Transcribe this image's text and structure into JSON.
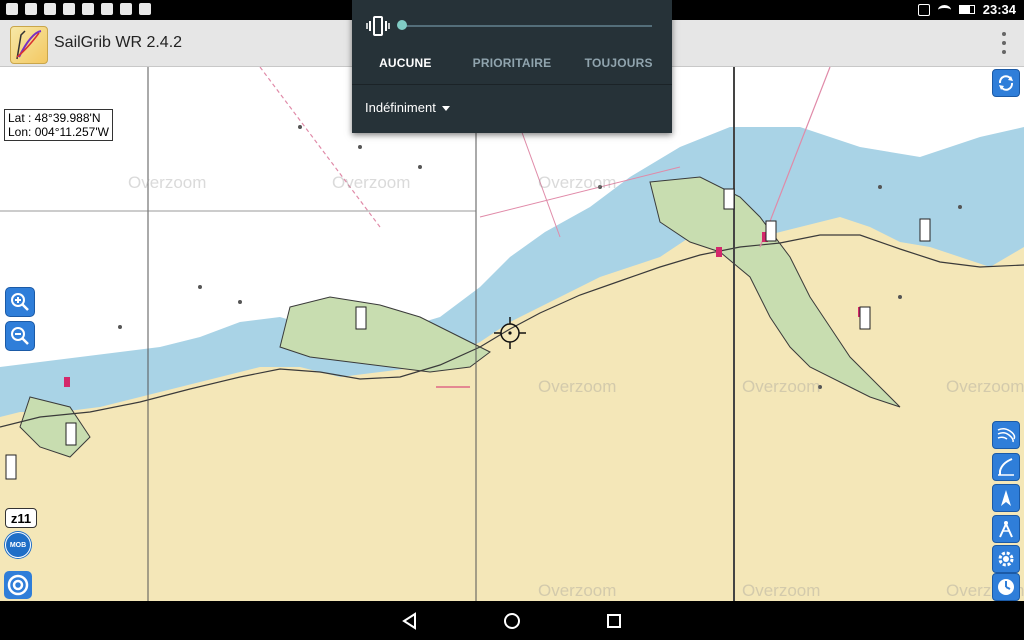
{
  "status_bar": {
    "time": "23:34"
  },
  "app": {
    "title": "SailGrib WR 2.4.2"
  },
  "map": {
    "coords": {
      "lat": "Lat :  48°39.988'N",
      "lon": "Lon: 004°11.257'W"
    },
    "overzoom_label": "Overzoom",
    "zoom_level": "z11",
    "mob_label": "MOB"
  },
  "popup": {
    "tabs": [
      "AUCUNE",
      "PRIORITAIRE",
      "TOUJOURS"
    ],
    "active_tab": "AUCUNE",
    "duration": "Indéfiniment",
    "slider_value": 0
  },
  "colors": {
    "land": "#f4e7b8",
    "sea_shallow": "#a9d3e6",
    "sea": "#ffffff",
    "intertidal": "#c8ddb0",
    "button": "#2f7ed9",
    "popup_bg": "#263238",
    "accent": "#80cbc4"
  }
}
